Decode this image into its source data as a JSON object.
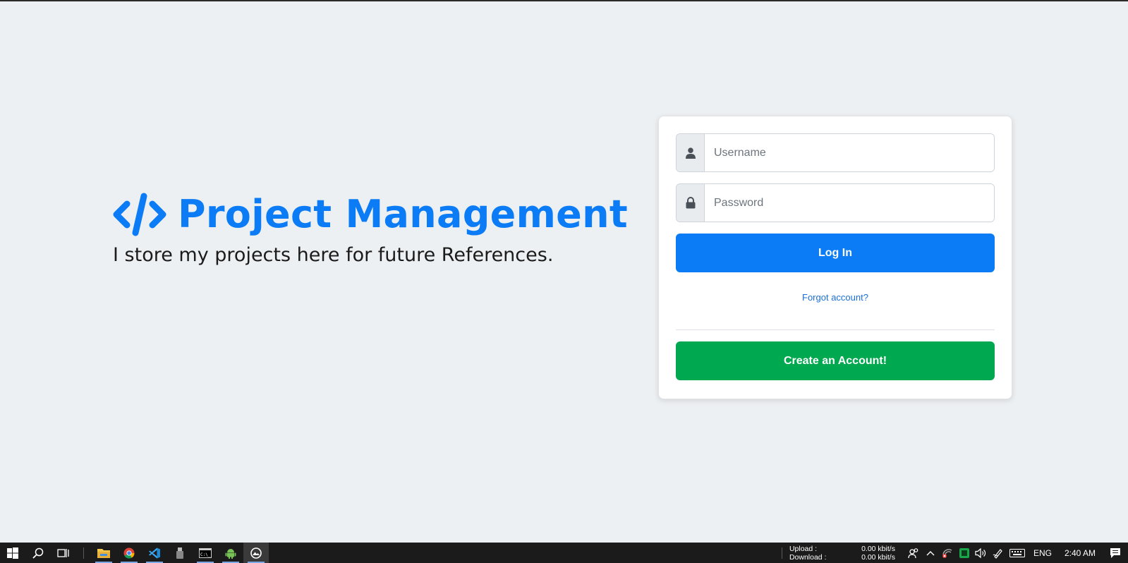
{
  "brand": {
    "title": "Project Management",
    "subtitle": "I store my projects here for future References.",
    "icon": "code-icon",
    "accent_color": "#0b7cf5"
  },
  "login": {
    "username_placeholder": "Username",
    "username_value": "",
    "password_placeholder": "Password",
    "password_value": "",
    "login_label": "Log In",
    "forgot_label": "Forgot account?",
    "create_label": "Create an Account!",
    "login_color": "#0b7cf5",
    "create_color": "#00a84f"
  },
  "taskbar": {
    "apps": [
      {
        "name": "file-explorer-icon",
        "running": true
      },
      {
        "name": "chrome-icon",
        "running": true
      },
      {
        "name": "vscode-icon",
        "running": true
      },
      {
        "name": "usb-device-icon",
        "running": false
      },
      {
        "name": "command-prompt-icon",
        "running": true
      },
      {
        "name": "android-icon",
        "running": true
      },
      {
        "name": "photos-icon",
        "running": true,
        "active": true
      }
    ],
    "net": {
      "upload_label": "Upload :",
      "upload_value": "0.00 kbit/s",
      "download_label": "Download :",
      "download_value": "0.00 kbit/s"
    },
    "language": "ENG",
    "time": "2:40 AM"
  }
}
